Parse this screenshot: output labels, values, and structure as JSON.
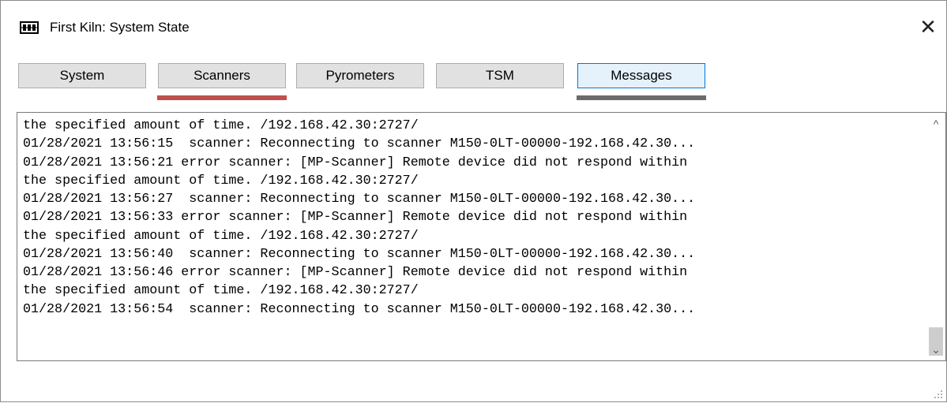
{
  "window": {
    "title": "First Kiln: System State",
    "close_symbol": "✕"
  },
  "tabs": [
    {
      "label": "System",
      "active": false
    },
    {
      "label": "Scanners",
      "active": false
    },
    {
      "label": "Pyrometers",
      "active": false
    },
    {
      "label": "TSM",
      "active": false
    },
    {
      "label": "Messages",
      "active": true
    }
  ],
  "tab_indicators": {
    "scanners_color": "#c0504d",
    "messages_color": "#6b6b6b"
  },
  "log": {
    "lines": [
      "the specified amount of time. /192.168.42.30:2727/",
      "01/28/2021 13:56:15  scanner: Reconnecting to scanner M150-0LT-00000-192.168.42.30...",
      "01/28/2021 13:56:21 error scanner: [MP-Scanner] Remote device did not respond within",
      "the specified amount of time. /192.168.42.30:2727/",
      "01/28/2021 13:56:27  scanner: Reconnecting to scanner M150-0LT-00000-192.168.42.30...",
      "01/28/2021 13:56:33 error scanner: [MP-Scanner] Remote device did not respond within",
      "the specified amount of time. /192.168.42.30:2727/",
      "01/28/2021 13:56:40  scanner: Reconnecting to scanner M150-0LT-00000-192.168.42.30...",
      "01/28/2021 13:56:46 error scanner: [MP-Scanner] Remote device did not respond within",
      "the specified amount of time. /192.168.42.30:2727/",
      "01/28/2021 13:56:54  scanner: Reconnecting to scanner M150-0LT-00000-192.168.42.30..."
    ]
  },
  "scrollbar": {
    "up_symbol": "^",
    "down_symbol": "⌄",
    "scroll_position_percent": 100
  },
  "icons": {
    "app": "kiln-window-icon",
    "close": "close-icon",
    "up": "chevron-up-icon",
    "down": "chevron-down-icon",
    "resize": "resize-grip-icon"
  }
}
